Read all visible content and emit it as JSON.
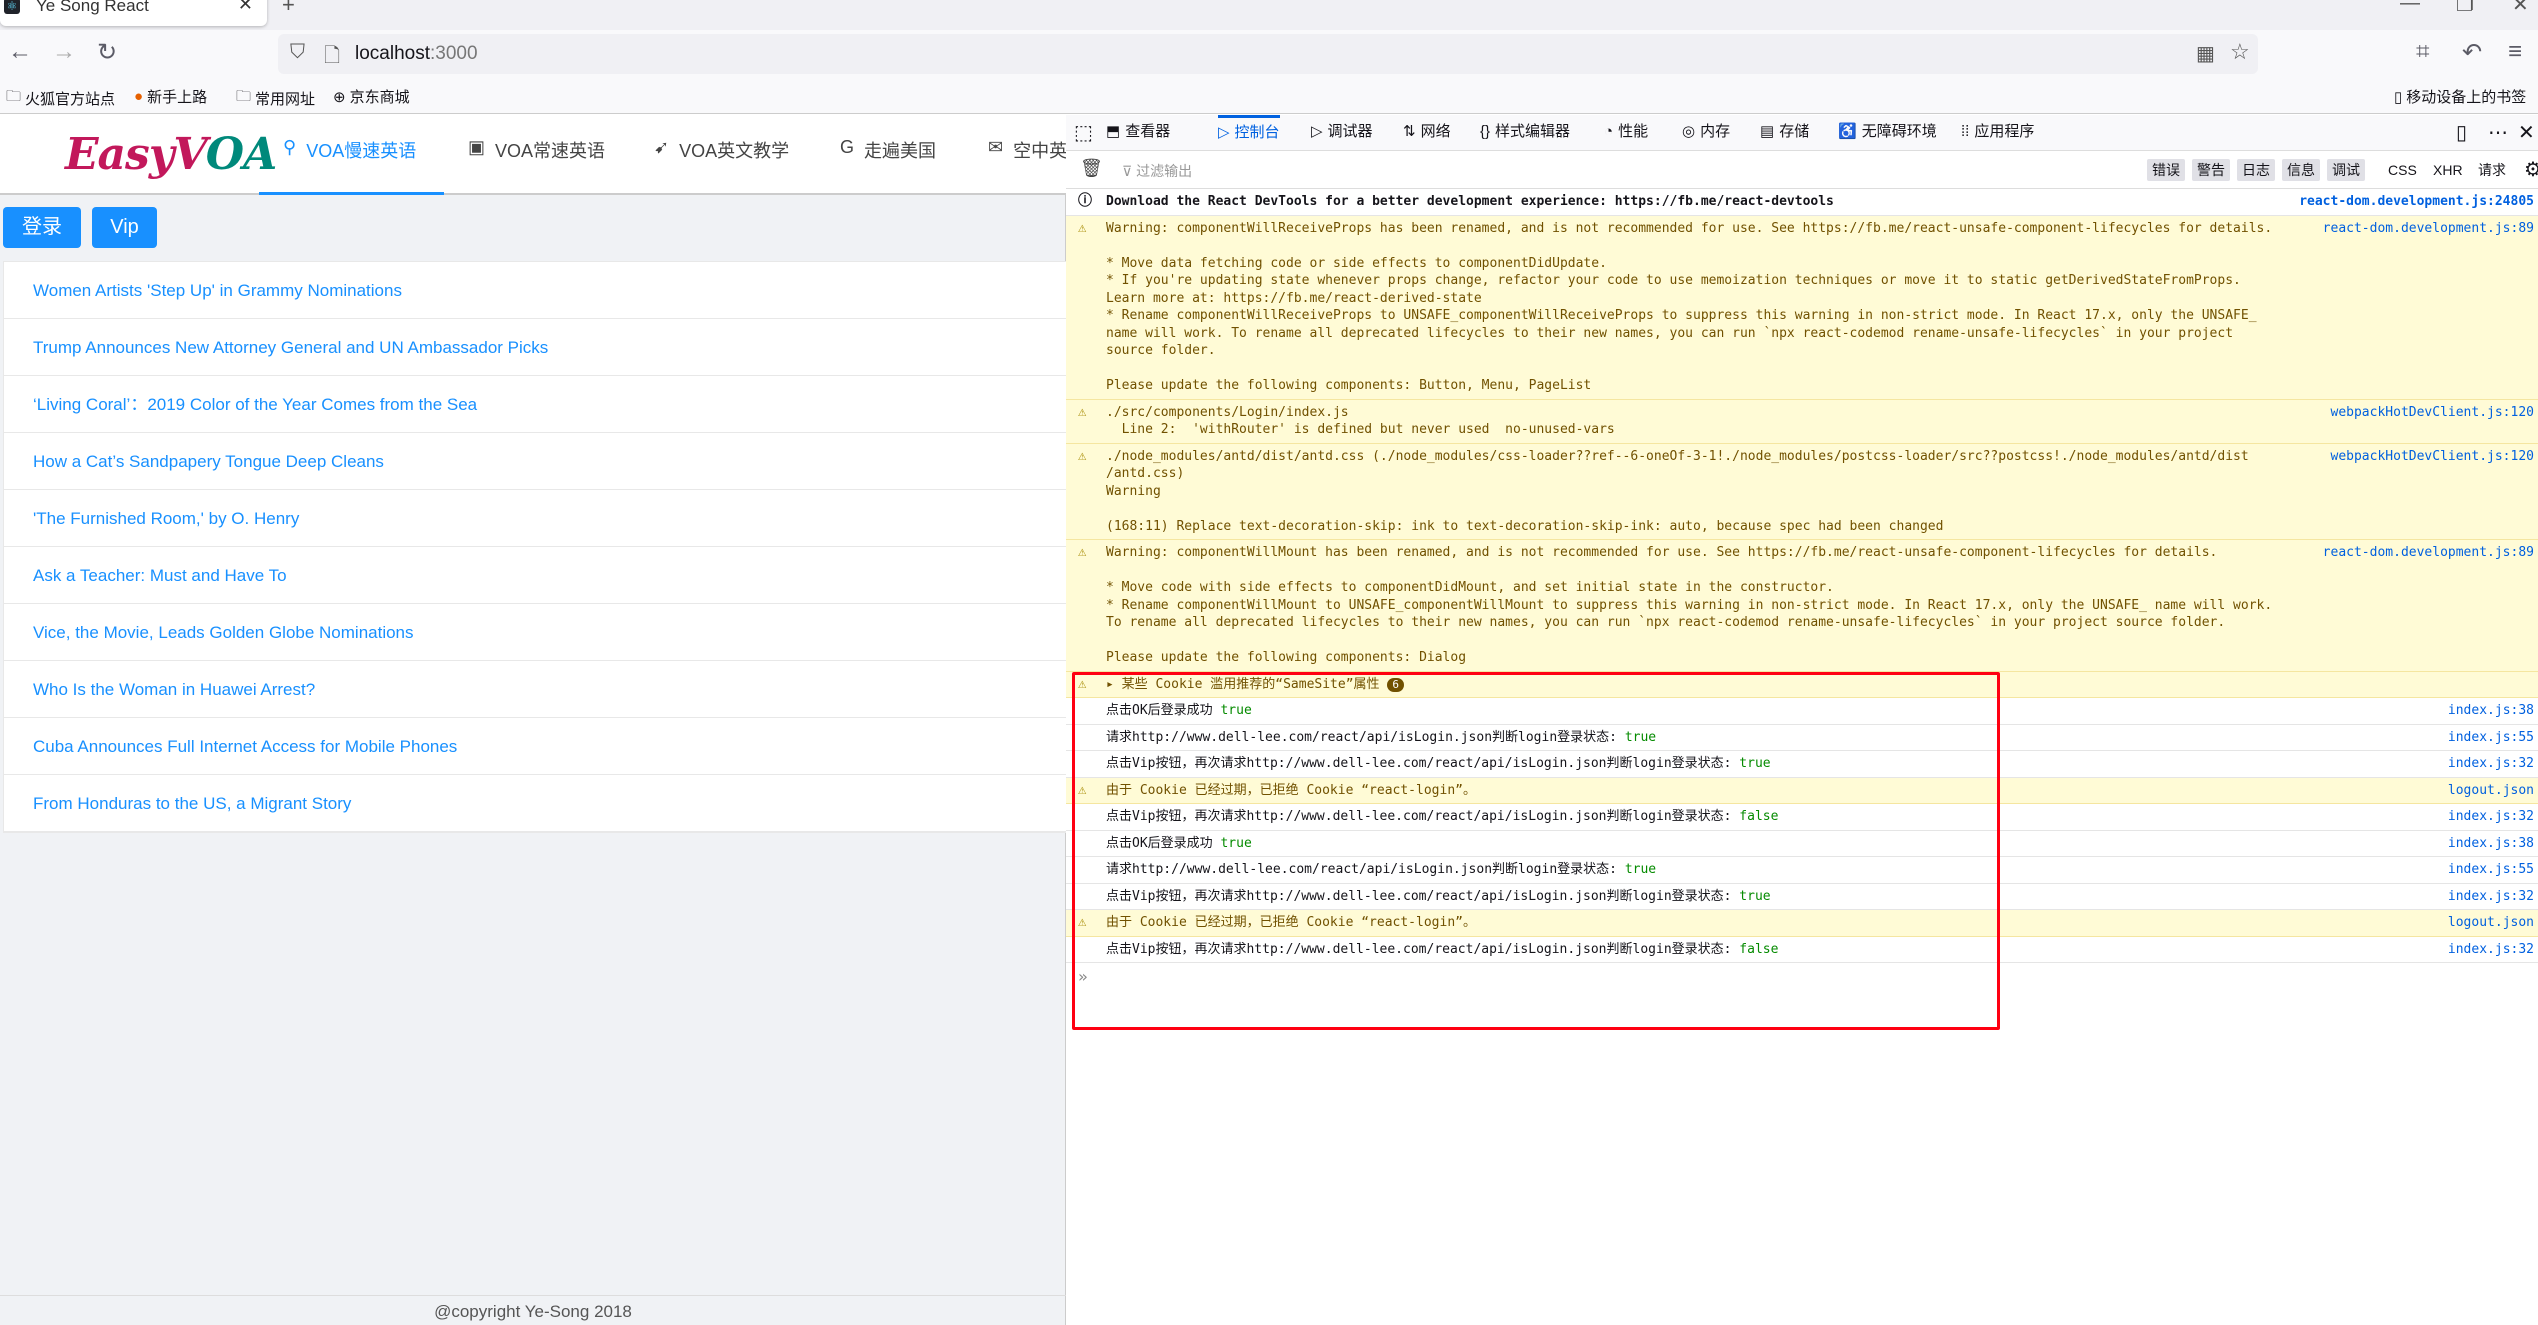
{
  "browser": {
    "tab_title": "Ye Song React",
    "url_host": "localhost",
    "url_port": ":3000",
    "bookmarks": [
      "火狐官方站点",
      "新手上路",
      "常用网址",
      "京东商城"
    ],
    "mobile_bookmarks": "移动设备上的书签"
  },
  "app": {
    "logo": "EasyVOA",
    "nav": [
      {
        "label": "VOA慢速英语",
        "icon": "person-icon",
        "active": true
      },
      {
        "label": "VOA常速英语",
        "icon": "id-card-icon"
      },
      {
        "label": "VOA英文教学",
        "icon": "pushpin-icon"
      },
      {
        "label": "走遍美国",
        "icon": "google-icon"
      },
      {
        "label": "空中英",
        "icon": "wechat-icon"
      }
    ],
    "login_label": "登录",
    "vip_label": "Vip",
    "articles": [
      "Women Artists 'Step Up' in Grammy Nominations",
      "Trump Announces New Attorney General and UN Ambassador Picks",
      "‘Living Coral’：2019 Color of the Year Comes from the Sea",
      "How a Cat’s Sandpapery Tongue Deep Cleans",
      "'The Furnished Room,' by O. Henry",
      "Ask a Teacher: Must and Have To",
      "Vice, the Movie, Leads Golden Globe Nominations",
      "Who Is the Woman in Huawei Arrest?",
      "Cuba Announces Full Internet Access for Mobile Phones",
      "From Honduras to the US, a Migrant Story"
    ],
    "footer": "@copyright Ye-Song 2018"
  },
  "devtools": {
    "tabs": [
      "查看器",
      "控制台",
      "调试器",
      "网络",
      "样式编辑器",
      "性能",
      "内存",
      "存储",
      "无障碍环境",
      "应用程序"
    ],
    "active_tab": "控制台",
    "filter_placeholder": "过滤输出",
    "level_buttons": [
      "错误",
      "警告",
      "日志",
      "信息",
      "调试"
    ],
    "extra_filters": [
      "CSS",
      "XHR",
      "请求"
    ],
    "messages": [
      {
        "type": "info",
        "lines": [
          "Download the React DevTools for a better development experience: https://fb.me/react-devtools"
        ],
        "source": "react-dom.development.js:24805"
      },
      {
        "type": "warn",
        "lines": [
          "Warning: componentWillReceiveProps has been renamed, and is not recommended for use. See https://fb.me/react-unsafe-component-lifecycles for details.",
          "",
          "* Move data fetching code or side effects to componentDidUpdate.",
          "* If you're updating state whenever props change, refactor your code to use memoization techniques or move it to static getDerivedStateFromProps.",
          "Learn more at: https://fb.me/react-derived-state",
          "* Rename componentWillReceiveProps to UNSAFE_componentWillReceiveProps to suppress this warning in non-strict mode. In React 17.x, only the UNSAFE_",
          "name will work. To rename all deprecated lifecycles to their new names, you can run `npx react-codemod rename-unsafe-lifecycles` in your project",
          "source folder.",
          "",
          "Please update the following components: Button, Menu, PageList"
        ],
        "source": "react-dom.development.js:89"
      },
      {
        "type": "warn",
        "lines": [
          "./src/components/Login/index.js",
          "  Line 2:  'withRouter' is defined but never used  no-unused-vars"
        ],
        "source": "webpackHotDevClient.js:120"
      },
      {
        "type": "warn",
        "lines": [
          "./node_modules/antd/dist/antd.css (./node_modules/css-loader??ref--6-oneOf-3-1!./node_modules/postcss-loader/src??postcss!./node_modules/antd/dist",
          "/antd.css)",
          "Warning",
          "",
          "(168:11) Replace text-decoration-skip: ink to text-decoration-skip-ink: auto, because spec had been changed"
        ],
        "source": "webpackHotDevClient.js:120"
      },
      {
        "type": "warn",
        "lines": [
          "Warning: componentWillMount has been renamed, and is not recommended for use. See https://fb.me/react-unsafe-component-lifecycles for details.",
          "",
          "* Move code with side effects to componentDidMount, and set initial state in the constructor.",
          "* Rename componentWillMount to UNSAFE_componentWillMount to suppress this warning in non-strict mode. In React 17.x, only the UNSAFE_ name will work.",
          "To rename all deprecated lifecycles to their new names, you can run `npx react-codemod rename-unsafe-lifecycles` in your project source folder.",
          "",
          "Please update the following components: Dialog"
        ],
        "source": "react-dom.development.js:89"
      },
      {
        "type": "warn-group",
        "lines": [
          "▸ 某些 Cookie 滥用推荐的“SameSite”属性 "
        ],
        "count": "6",
        "source": ""
      },
      {
        "type": "log",
        "lines": [
          "点击OK后登录成功 "
        ],
        "value": "true",
        "source": "index.js:38"
      },
      {
        "type": "log",
        "lines": [
          "请求http://www.dell-lee.com/react/api/isLogin.json判断login登录状态: "
        ],
        "value": "true",
        "source": "index.js:55"
      },
      {
        "type": "log",
        "lines": [
          "点击Vip按钮，再次请求http://www.dell-lee.com/react/api/isLogin.json判断login登录状态: "
        ],
        "value": "true",
        "source": "index.js:32"
      },
      {
        "type": "warn",
        "lines": [
          "由于 Cookie 已经过期，已拒绝 Cookie “react-login”。"
        ],
        "source": "logout.json"
      },
      {
        "type": "log",
        "lines": [
          "点击Vip按钮，再次请求http://www.dell-lee.com/react/api/isLogin.json判断login登录状态: "
        ],
        "value": "false",
        "source": "index.js:32"
      },
      {
        "type": "log",
        "lines": [
          "点击OK后登录成功 "
        ],
        "value": "true",
        "source": "index.js:38"
      },
      {
        "type": "log",
        "lines": [
          "请求http://www.dell-lee.com/react/api/isLogin.json判断login登录状态: "
        ],
        "value": "true",
        "source": "index.js:55"
      },
      {
        "type": "log",
        "lines": [
          "点击Vip按钮，再次请求http://www.dell-lee.com/react/api/isLogin.json判断login登录状态: "
        ],
        "value": "true",
        "source": "index.js:32"
      },
      {
        "type": "warn",
        "lines": [
          "由于 Cookie 已经过期，已拒绝 Cookie “react-login”。"
        ],
        "source": "logout.json"
      },
      {
        "type": "log",
        "lines": [
          "点击Vip按钮，再次请求http://www.dell-lee.com/react/api/isLogin.json判断login登录状态: "
        ],
        "value": "false",
        "source": "index.js:32"
      }
    ],
    "prompt": "»"
  },
  "colors": {
    "accent": "#1890ff",
    "highlight_box": "#ff0011",
    "warning_bg": "#fffbd6"
  }
}
